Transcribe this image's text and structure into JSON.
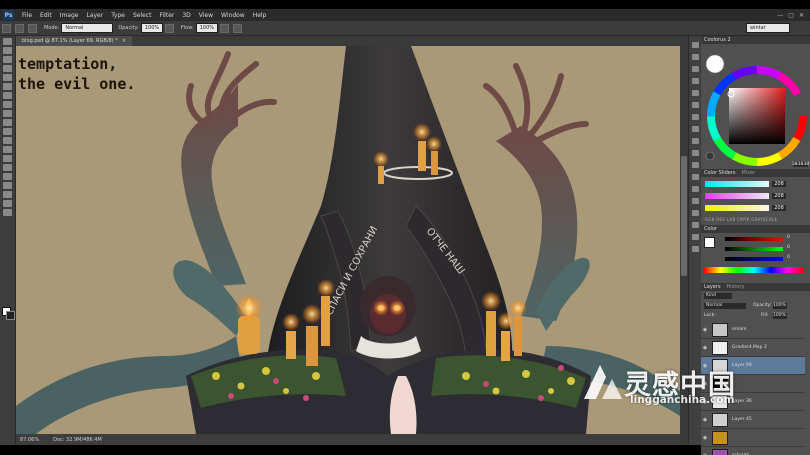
{
  "app": {
    "logo": "Ps"
  },
  "menu": [
    "File",
    "Edit",
    "Image",
    "Layer",
    "Type",
    "Select",
    "Filter",
    "3D",
    "View",
    "Window",
    "Help"
  ],
  "window_buttons": [
    "—",
    "▢",
    "✕"
  ],
  "options_bar": {
    "mode_label": "Mode:",
    "mode_value": "Normal",
    "opacity_label": "Opacity:",
    "opacity_value": "100%",
    "flow_label": "Flow:",
    "flow_value": "100%",
    "workspace": "wintar"
  },
  "document": {
    "tab_title": "blog.psd @ 87.1% (Layer 69, RGB/8) *",
    "close": "×"
  },
  "artwork": {
    "caption_line1": "temptation,",
    "caption_line2": "the evil one.",
    "banner_text_1": "СПАСИ И СОХРАНИ",
    "banner_text_2": "ОТЧЕ НАШ"
  },
  "status": {
    "zoom": "87.06%",
    "doc": "Doc: 32.9M/486.4M"
  },
  "panels": {
    "coolorus_title": "Coolorus 2",
    "color_sliders_title": "Color Sliders",
    "mixer_title": "Mixer",
    "hex_value": "383838",
    "sliders": [
      {
        "value": "208",
        "color_a": "#00e8f0",
        "color_b": "#e8f8f8"
      },
      {
        "value": "208",
        "color_a": "#e040f0",
        "color_b": "#f0e8f0"
      },
      {
        "value": "208",
        "color_a": "#f0f000",
        "color_b": "#f8f8e8"
      }
    ],
    "slider_modes": "RGB  HSV  LAB  CMYK  GRAYSCALE",
    "color_title": "Color",
    "color_values": [
      "0",
      "0",
      "0"
    ],
    "layers_tabs": [
      "Layers",
      "History"
    ],
    "kind_label": "Kind",
    "blend_mode": "Normal",
    "opacity_label": "Opacity:",
    "opacity_value": "100%",
    "lock_label": "Lock:",
    "fill_label": "Fill:",
    "fill_value": "100%",
    "layers": [
      {
        "name": "ornam",
        "thumb": "#c8c8c8",
        "selected": false
      },
      {
        "name": "Gradient Map 2",
        "thumb": "#f0f0f0",
        "selected": false
      },
      {
        "name": "Layer 69",
        "thumb": "#d8d8d8",
        "selected": true
      },
      {
        "name": "",
        "thumb": "#000000",
        "selected": false
      },
      {
        "name": "Layer 36",
        "thumb": "#e8e8e8",
        "selected": false
      },
      {
        "name": "Layer 45",
        "thumb": "#d0d0d0",
        "selected": false
      },
      {
        "name": "",
        "thumb": "#c89020",
        "selected": false
      },
      {
        "name": "sch-sim",
        "thumb": "#a050b0",
        "selected": false
      }
    ]
  },
  "watermark": {
    "brand": "灵感中国",
    "url": "lingganchina.com"
  }
}
